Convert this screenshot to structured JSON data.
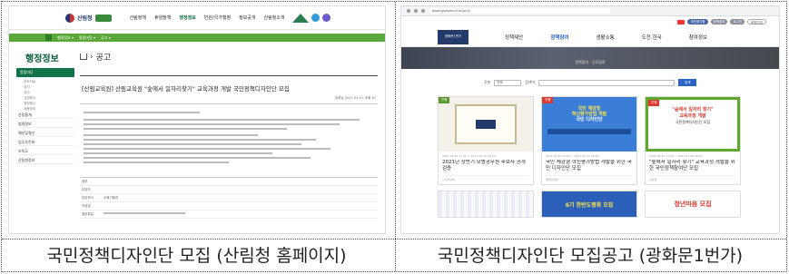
{
  "captions": {
    "left": "국민정책디자인단 모집 (산림청 홈페이지)",
    "right": "국민정책디자인단 모집공고 (광화문1번가)"
  },
  "left": {
    "header_nav": [
      "산림정책",
      "휴양정책",
      "행정정보",
      "민원/국가행정",
      "정보공개",
      "산림청소개"
    ],
    "header_nav_active_index": 2,
    "sidebar_title": "행정정보",
    "sidebar_active": "알림마당",
    "sidebar_items": [
      "산림통계",
      "법령정보",
      "예산및결산",
      "업무추진비",
      "조직도",
      "산림청정보"
    ],
    "breadcrumb": "공고",
    "post_title": "[산림교육원] 산림교육원 \"숲에서 일자리찾기\" 교육과정 개발 국민정책디자인단 모집",
    "post_date": "등록일 2021.03.10. 조회 87",
    "meta": [
      {
        "k": "첨부",
        "v": ""
      },
      {
        "k": "담당자",
        "v": ""
      },
      {
        "k": "담당부서",
        "v": "교육기획과"
      },
      {
        "k": "작성일",
        "v": ""
      },
      {
        "k": "첨부파일",
        "v": ""
      }
    ]
  },
  "right": {
    "url": "gwanghwamun1st.go.kr",
    "util_pills": [
      "국민생각함",
      "정책참여",
      "로그인",
      "회원가입"
    ],
    "gnb": [
      "정책제안",
      "정책참여",
      "생활소통",
      "도전.한국",
      "참여정보"
    ],
    "gnb_active_index": 1,
    "banner_text": "정책참여 · 공모참여",
    "search": {
      "label": "구분",
      "select": "전체",
      "keyword_label": "검색어",
      "button": "검색"
    },
    "cards": [
      {
        "tag": "진행",
        "date": "2021-03-10 17:00 ~ 2021-03-19 18:00",
        "title": "2021년 상반기 모범공무원 후보자 공개검증",
        "foot": "인사혁신처"
      },
      {
        "tag": "진행",
        "date": "2021-03-10 17:00 ~ 2021-03-17 18:00",
        "title": "국민 체감형 혁신평가방법 개발을 위한 국민 디자인단 모집",
        "foot": "행정안전부",
        "thumb": {
          "l1": "국민 체감형",
          "l2": "혁신평가방법 개발",
          "l3": "국민 디자인단"
        }
      },
      {
        "tag": "진행",
        "date": "2021-03-10 17:00 ~ 2021-03-25 18:00",
        "title": "\"숲에서 일자리 찾기\" 교육과정 개발을 위한 국민정책참여단 모집",
        "foot": "산림청",
        "thumb": {
          "l1": "\"숲에서 일자리 찾기\"",
          "l2": "교육과정 개발",
          "l3": "국민정책디자인단 모집"
        }
      }
    ],
    "cards_row2": [
      {
        "text": ""
      },
      {
        "text": "6기 한반도평화 모집"
      },
      {
        "text": "청년마음 모집"
      }
    ]
  }
}
